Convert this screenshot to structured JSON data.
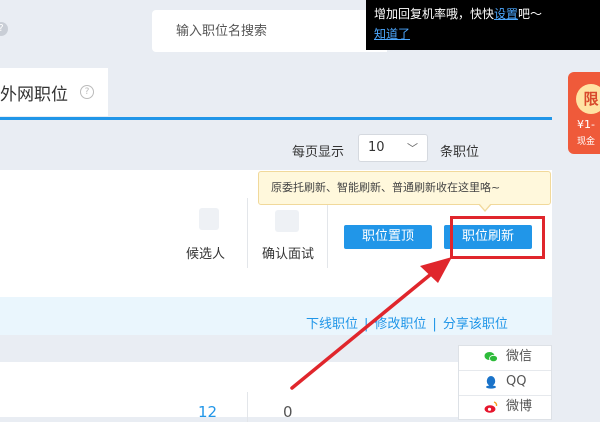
{
  "search": {
    "placeholder": "输入职位名搜索"
  },
  "top_tip": {
    "text": "增加回复机率哦，快快",
    "link1": "设置",
    "text2": "吧～",
    "link2": "知道了"
  },
  "tab": {
    "title": "外网职位",
    "help_icon": "?"
  },
  "promo": {
    "badge": "限",
    "line1": "¥1-",
    "line2": "现金"
  },
  "pagination": {
    "label": "每页显示",
    "value": "10",
    "unit": "条职位"
  },
  "stats": {
    "candidates_label": "候选人",
    "interview_label": "确认面试",
    "candidates_count": "12",
    "interview_count": "0"
  },
  "buttons": {
    "pin": "职位置顶",
    "refresh": "职位刷新"
  },
  "refresh_tip": "原委托刷新、智能刷新、普通刷新收在这里咯~",
  "actions": {
    "offline": "下线职位",
    "edit": "修改职位",
    "share": "分享该职位"
  },
  "share_menu": {
    "wechat": "微信",
    "qq": "QQ",
    "weibo": "微博"
  },
  "colors": {
    "accent": "#2196e8",
    "highlight_red": "#e0262c",
    "tip_bg": "#fff8dc"
  }
}
